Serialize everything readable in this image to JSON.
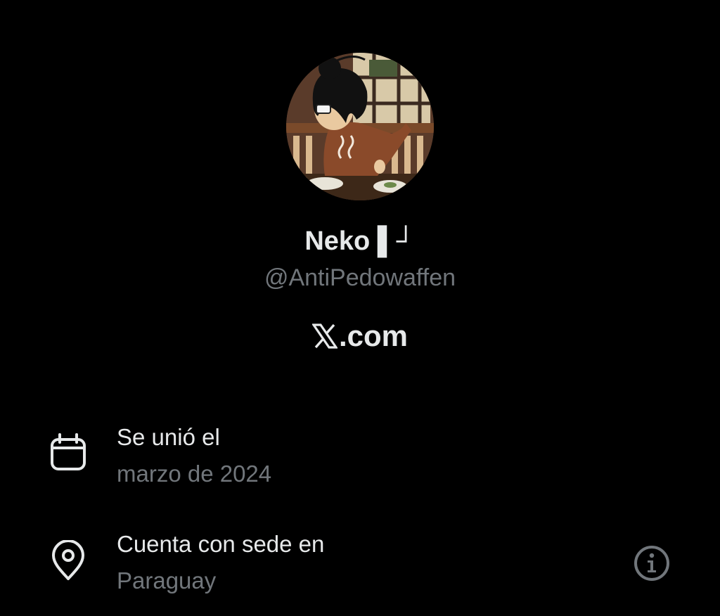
{
  "profile": {
    "display_name": "Neko ▌┘",
    "handle": "@AntiPedowaffen",
    "brand_suffix": ".com"
  },
  "about": {
    "joined_label": "Se unió el",
    "joined_value": "marzo de 2024",
    "location_label": "Cuenta con sede en",
    "location_value": "Paraguay"
  },
  "icons": {
    "joined": "calendar-icon",
    "location": "location-pin-icon",
    "info": "info-icon",
    "brand": "x-logo-icon"
  },
  "colors": {
    "background": "#000000",
    "primary_text": "#e7e9ea",
    "secondary_text": "#71767b"
  }
}
